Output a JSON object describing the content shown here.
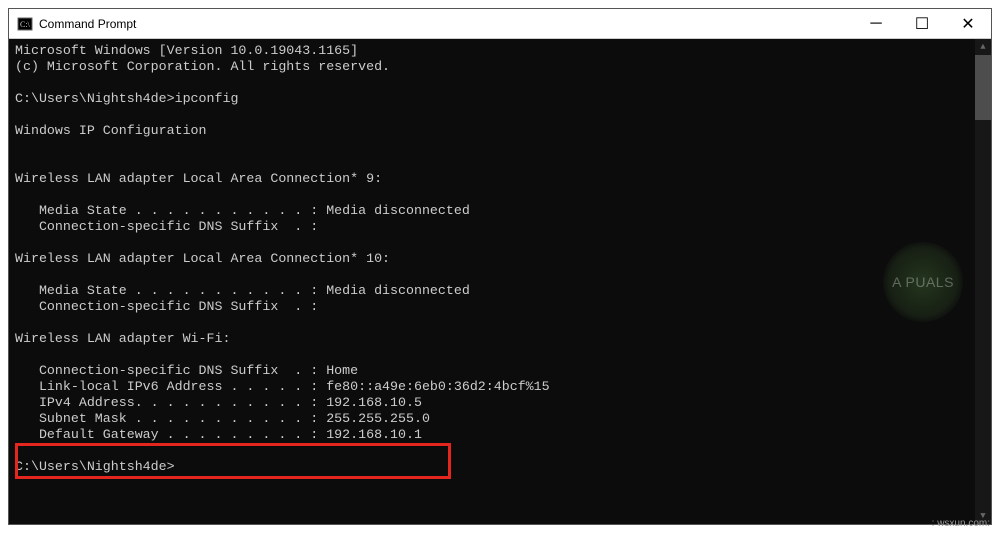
{
  "titlebar": {
    "title": "Command Prompt",
    "minimize": "─",
    "maximize": "☐",
    "close": "✕"
  },
  "scroll": {
    "up": "▲",
    "down": "▼"
  },
  "term": {
    "line01": "Microsoft Windows [Version 10.0.19043.1165]",
    "line02": "(c) Microsoft Corporation. All rights reserved.",
    "blank": "",
    "prompt1": "C:\\Users\\Nightsh4de>ipconfig",
    "header": "Windows IP Configuration",
    "adapter9": "Wireless LAN adapter Local Area Connection* 9:",
    "media_disc": "   Media State . . . . . . . . . . . : Media disconnected",
    "dns_empty": "   Connection-specific DNS Suffix  . :",
    "adapter10": "Wireless LAN adapter Local Area Connection* 10:",
    "adapter_wifi": "Wireless LAN adapter Wi-Fi:",
    "dns_home": "   Connection-specific DNS Suffix  . : Home",
    "ipv6": "   Link-local IPv6 Address . . . . . : fe80::a49e:6eb0:36d2:4bcf%15",
    "ipv4": "   IPv4 Address. . . . . . . . . . . : 192.168.10.5",
    "subnet": "   Subnet Mask . . . . . . . . . . . : 255.255.255.0",
    "gateway": "   Default Gateway . . . . . . . . . : 192.168.10.1",
    "prompt2": "C:\\Users\\Nightsh4de>"
  },
  "watermark": {
    "text": "A PUALS"
  },
  "credit": ": wsxun.com:"
}
